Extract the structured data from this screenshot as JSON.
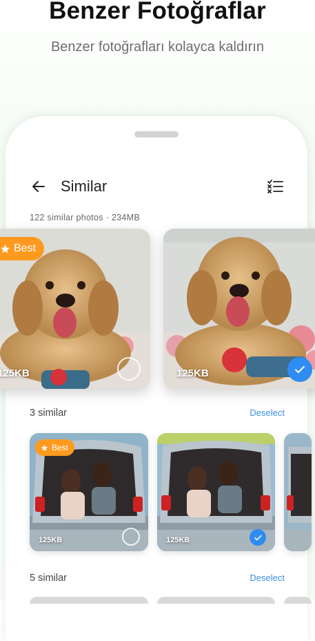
{
  "promo": {
    "headline": "Benzer Fotoğraflar",
    "subheadline": "Benzer fotoğrafları kolayca kaldırın"
  },
  "header": {
    "title": "Similar",
    "back_icon": "arrow-left-icon",
    "select_icon": "select-list-icon"
  },
  "summary": "122 similar photos · 234MB",
  "featured": {
    "cards": [
      {
        "size": "125KB",
        "best_label": "Best",
        "selected": false
      },
      {
        "size": "125KB",
        "selected": true
      }
    ]
  },
  "groups": [
    {
      "title": "3 similar",
      "deselect_label": "Deselect",
      "cards": [
        {
          "size": "125KB",
          "best_label": "Best",
          "selected": false
        },
        {
          "size": "125KB",
          "selected": true
        }
      ]
    },
    {
      "title": "5 similar",
      "deselect_label": "Deselect"
    }
  ],
  "colors": {
    "accent": "#2f8cf2",
    "best_badge": "#ff9a1f",
    "link": "#3a8de8"
  }
}
